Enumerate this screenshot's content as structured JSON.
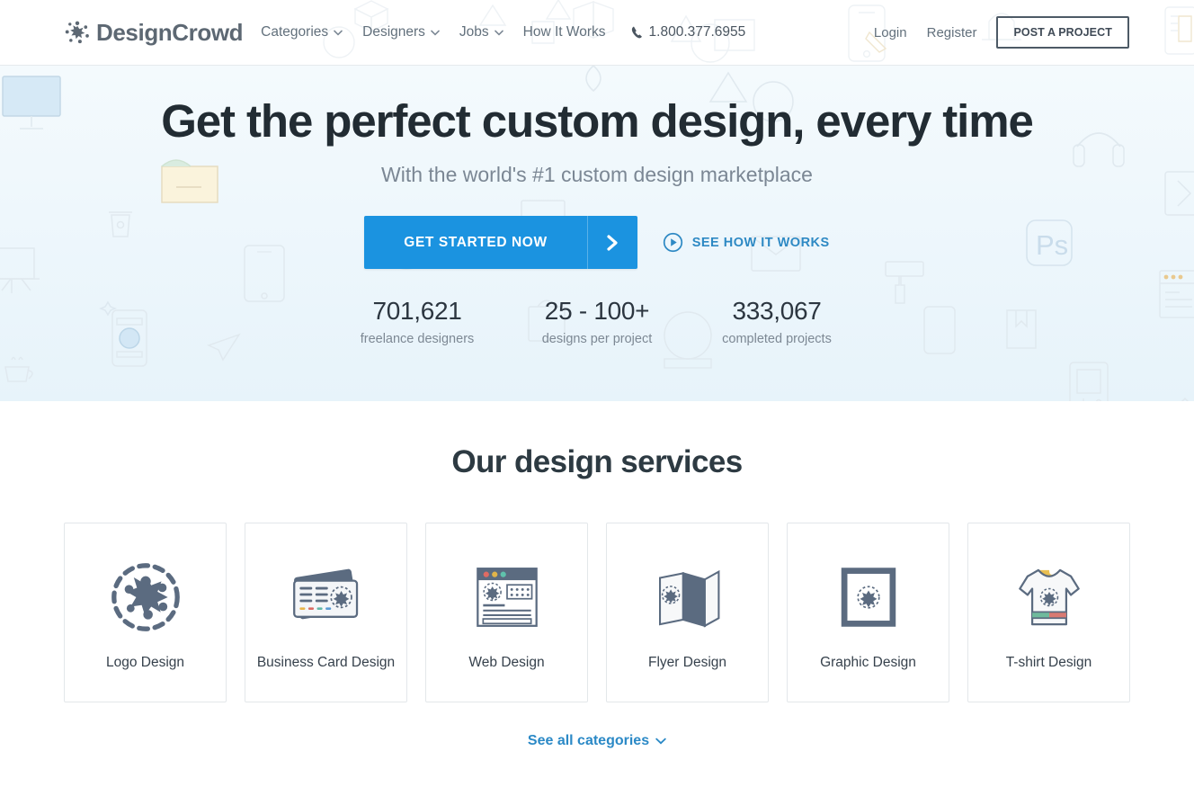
{
  "brand": {
    "name": "DesignCrowd",
    "mark_icon": "starburst-logo-icon"
  },
  "header": {
    "nav": [
      {
        "label": "Categories",
        "icon": "chevron-down-icon"
      },
      {
        "label": "Designers",
        "icon": "chevron-down-icon"
      },
      {
        "label": "Jobs",
        "icon": "chevron-down-icon"
      },
      {
        "label": "How It Works",
        "icon": ""
      }
    ],
    "phone": {
      "icon": "phone-icon",
      "number": "1.800.377.6955"
    },
    "login_label": "Login",
    "register_label": "Register",
    "post_project_label": "POST A PROJECT"
  },
  "hero": {
    "title": "Get the perfect custom design, every time",
    "subtitle": "With the world's #1 custom design marketplace",
    "cta_label": "GET STARTED NOW",
    "cta_arrow_icon": "chevron-right-icon",
    "see_how_label": "SEE HOW IT WORKS",
    "see_how_icon": "play-circle-icon",
    "stats": [
      {
        "value": "701,621",
        "label": "freelance designers"
      },
      {
        "value": "25 - 100+",
        "label": "designs per project"
      },
      {
        "value": "333,067",
        "label": "completed projects"
      }
    ]
  },
  "services": {
    "title": "Our design services",
    "cards": [
      {
        "label": "Logo Design",
        "icon": "logo-design-icon"
      },
      {
        "label": "Business Card Design",
        "icon": "business-card-design-icon"
      },
      {
        "label": "Web Design",
        "icon": "web-design-icon"
      },
      {
        "label": "Flyer Design",
        "icon": "flyer-design-icon"
      },
      {
        "label": "Graphic Design",
        "icon": "graphic-design-icon"
      },
      {
        "label": "T-shirt Design",
        "icon": "tshirt-design-icon"
      }
    ],
    "see_all_label": "See all categories",
    "see_all_icon": "chevron-down-icon"
  },
  "colors": {
    "accent_blue": "#1b93e0",
    "link_blue": "#2b89c6",
    "text_dark": "#2c3640",
    "text_muted": "#7d8894",
    "icon_slate": "#5b6b80",
    "hero_bg_top": "#f4fafd",
    "hero_bg_bottom": "#e7f3fa"
  }
}
